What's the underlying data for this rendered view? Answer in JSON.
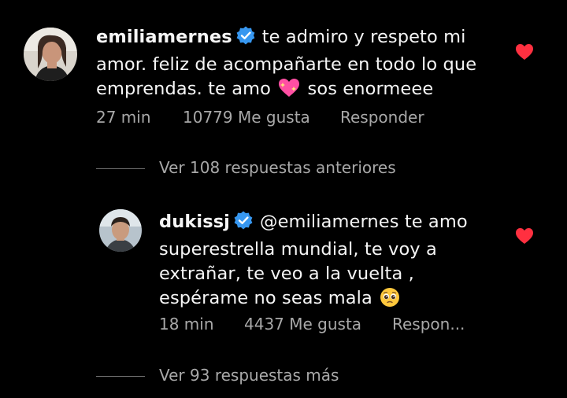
{
  "comments": [
    {
      "username": "emiliamernes",
      "verified": true,
      "text_before_emoji": "te admiro y respeto mi amor. feliz de acompañarte en todo lo que emprendas. te amo",
      "emoji": "sparkling-heart",
      "text_after_emoji": "sos enormeee",
      "time": "27 min",
      "likes": "10779 Me gusta",
      "reply_label": "Responder",
      "liked": true
    },
    {
      "username": "dukissj",
      "verified": true,
      "mention": "@emiliamernes",
      "text_before_emoji": "te amo superestrella mundial, te voy a extrañar, te veo a la vuelta , espérame no seas mala",
      "emoji": "pleading-face",
      "time": "18 min",
      "likes": "4437 Me gusta",
      "reply_label": "Respon...",
      "liked": true
    }
  ],
  "replies_links": {
    "previous": "Ver 108 respuestas anteriores",
    "more": "Ver 93 respuestas más"
  },
  "colors": {
    "background": "#000000",
    "text": "#f5f5f5",
    "secondary": "#a8a8a8",
    "verified_badge": "#3797f0",
    "heart": "#ff3040"
  }
}
